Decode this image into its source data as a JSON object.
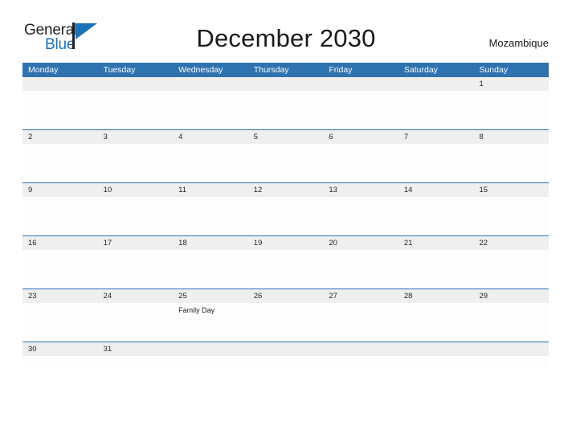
{
  "logo": {
    "word_one": "General",
    "word_two": "Blue",
    "flag_icon": "blue-flag-triangle-icon",
    "brand_blue": "#1b72b8",
    "brand_dark": "#231f20"
  },
  "header": {
    "title": "December 2030",
    "country": "Mozambique"
  },
  "theme": {
    "header_blue": "#2e72b0",
    "band_gray": "#efefef",
    "cell_white": "#fdfdfd",
    "text_dark": "#262626"
  },
  "calendar": {
    "weekdays": [
      "Monday",
      "Tuesday",
      "Wednesday",
      "Thursday",
      "Friday",
      "Saturday",
      "Sunday"
    ],
    "weeks": [
      {
        "days": [
          {
            "number": "",
            "events": []
          },
          {
            "number": "",
            "events": []
          },
          {
            "number": "",
            "events": []
          },
          {
            "number": "",
            "events": []
          },
          {
            "number": "",
            "events": []
          },
          {
            "number": "",
            "events": []
          },
          {
            "number": "1",
            "events": []
          }
        ]
      },
      {
        "days": [
          {
            "number": "2",
            "events": []
          },
          {
            "number": "3",
            "events": []
          },
          {
            "number": "4",
            "events": []
          },
          {
            "number": "5",
            "events": []
          },
          {
            "number": "6",
            "events": []
          },
          {
            "number": "7",
            "events": []
          },
          {
            "number": "8",
            "events": []
          }
        ]
      },
      {
        "days": [
          {
            "number": "9",
            "events": []
          },
          {
            "number": "10",
            "events": []
          },
          {
            "number": "11",
            "events": []
          },
          {
            "number": "12",
            "events": []
          },
          {
            "number": "13",
            "events": []
          },
          {
            "number": "14",
            "events": []
          },
          {
            "number": "15",
            "events": []
          }
        ]
      },
      {
        "days": [
          {
            "number": "16",
            "events": []
          },
          {
            "number": "17",
            "events": []
          },
          {
            "number": "18",
            "events": []
          },
          {
            "number": "19",
            "events": []
          },
          {
            "number": "20",
            "events": []
          },
          {
            "number": "21",
            "events": []
          },
          {
            "number": "22",
            "events": []
          }
        ]
      },
      {
        "days": [
          {
            "number": "23",
            "events": []
          },
          {
            "number": "24",
            "events": []
          },
          {
            "number": "25",
            "events": [
              "Family Day"
            ]
          },
          {
            "number": "26",
            "events": []
          },
          {
            "number": "27",
            "events": []
          },
          {
            "number": "28",
            "events": []
          },
          {
            "number": "29",
            "events": []
          }
        ]
      },
      {
        "days": [
          {
            "number": "30",
            "events": []
          },
          {
            "number": "31",
            "events": []
          },
          {
            "number": "",
            "events": []
          },
          {
            "number": "",
            "events": []
          },
          {
            "number": "",
            "events": []
          },
          {
            "number": "",
            "events": []
          },
          {
            "number": "",
            "events": []
          }
        ]
      }
    ]
  }
}
